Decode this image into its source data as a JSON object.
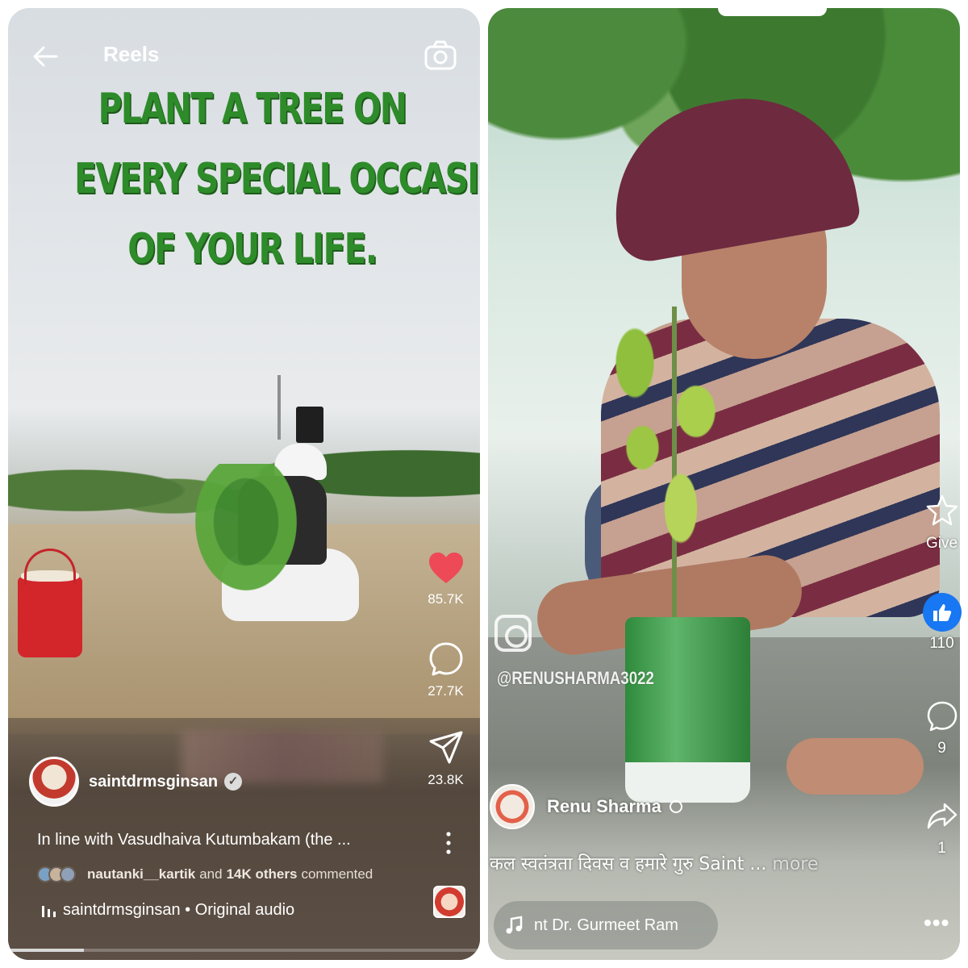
{
  "left_reel": {
    "header": {
      "title": "Reels"
    },
    "headline": [
      "PLANT A TREE ON",
      "EVERY SPECIAL OCCASION",
      "OF YOUR LIFE."
    ],
    "actions": {
      "likes": "85.7K",
      "comments": "27.7K",
      "shares": "23.8K",
      "like_color": "#ed4956"
    },
    "author": {
      "username": "saintdrmsginsan",
      "verified": true
    },
    "caption": "In line with Vasudhaiva Kutumbakam (the ...",
    "commenters": {
      "user": "nautanki__kartik",
      "joiner": "and",
      "others": "14K others",
      "suffix": "commented"
    },
    "audio": "saintdrmsginsan • Original audio",
    "progress": 0.16,
    "icons": [
      "back-arrow-icon",
      "camera-icon",
      "heart-icon",
      "comment-icon",
      "send-icon",
      "more-vertical-icon",
      "audio-bars-icon"
    ]
  },
  "right_reel": {
    "watermark_handle": "@RENUSHARMA3022",
    "actions": {
      "give_label": "Give",
      "likes": "110",
      "comments": "9",
      "shares": "1",
      "like_color": "#1877f2"
    },
    "author": {
      "name": "Renu Sharma"
    },
    "caption": "कल स्वतंत्रता दिवस व हमारे गुरु Saint ...",
    "caption_more": "more",
    "audio": "nt Dr. Gurmeet Ram",
    "more_label": "•••",
    "icons": [
      "star-icon",
      "like-icon",
      "comment-icon",
      "share-icon",
      "globe-icon",
      "music-note-icon",
      "instagram-icon"
    ]
  }
}
